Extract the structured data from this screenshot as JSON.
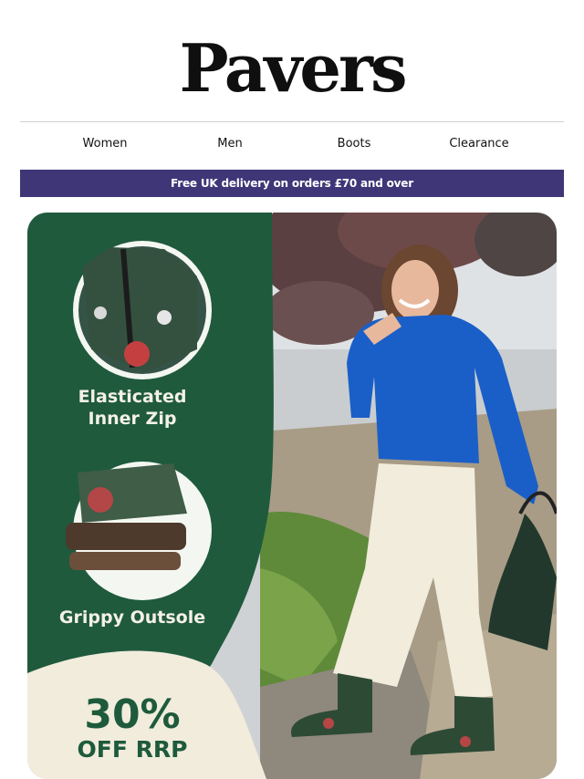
{
  "brand": {
    "logo": "Pavers"
  },
  "nav": {
    "items": [
      "Women",
      "Men",
      "Boots",
      "Clearance"
    ]
  },
  "banner": {
    "text": "Free UK delivery on orders £70 and over"
  },
  "hero": {
    "features": [
      {
        "label_line1": "Elasticated",
        "label_line2": "Inner Zip",
        "icon": "zip-closeup-image"
      },
      {
        "label_line1": "Grippy Outsole",
        "label_line2": "",
        "icon": "outsole-closeup-image"
      }
    ],
    "offer": {
      "line1": "30%",
      "line2": "OFF RRP"
    },
    "colors": {
      "panel_green": "#1f5a3d",
      "cream": "#f1ecdc",
      "sweater_blue": "#1a5fc8",
      "banner_purple": "#3f3678"
    }
  }
}
